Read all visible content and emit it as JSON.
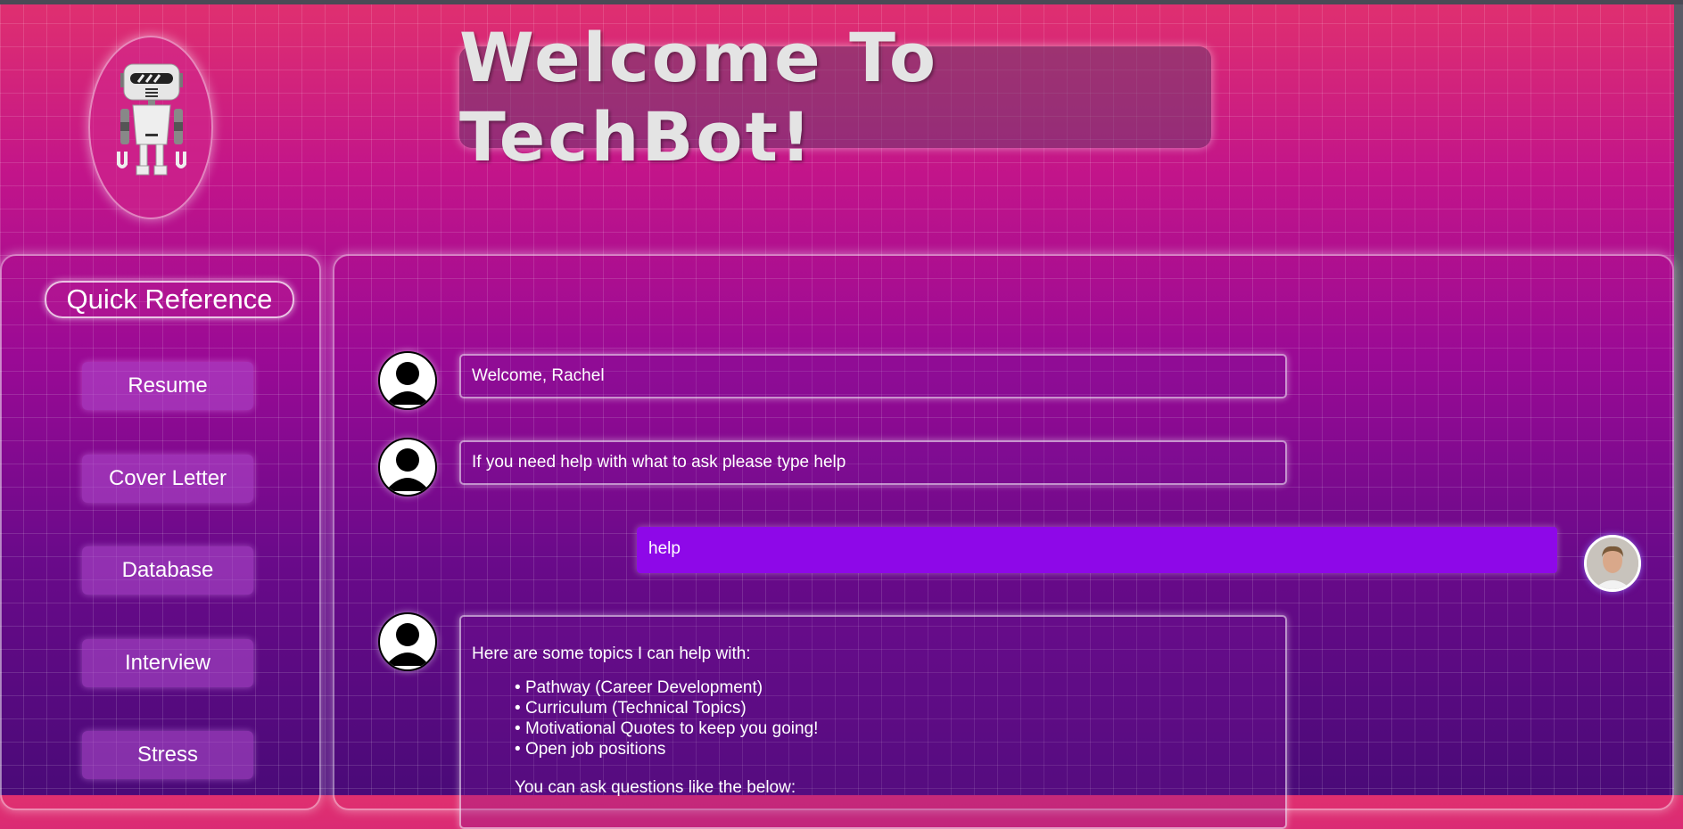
{
  "header": {
    "title": "Welcome To TechBot!"
  },
  "sidebar": {
    "title": "Quick Reference",
    "items": [
      {
        "label": "Resume"
      },
      {
        "label": "Cover Letter"
      },
      {
        "label": "Database"
      },
      {
        "label": "Interview"
      },
      {
        "label": "Stress"
      }
    ]
  },
  "chat": {
    "messages": [
      {
        "sender": "bot",
        "text": "Welcome, Rachel"
      },
      {
        "sender": "bot",
        "text": "If you need help with what to ask please type help"
      },
      {
        "sender": "user",
        "text": "help"
      },
      {
        "sender": "bot",
        "intro": "Here are some topics I can help with:",
        "topics": [
          "Pathway (Career Development)",
          "Curriculum (Technical Topics)",
          "Motivational Quotes to keep you going!",
          "Open job positions"
        ],
        "outro": "You can ask questions like the below:"
      }
    ]
  },
  "icons": {
    "logo": "robot-icon",
    "bot_avatar": "user-silhouette-icon",
    "user_avatar": "user-photo"
  },
  "colors": {
    "user_bubble": "#8e08e8",
    "gradient_top": "#e0306f",
    "gradient_bottom": "#4a0a78"
  }
}
